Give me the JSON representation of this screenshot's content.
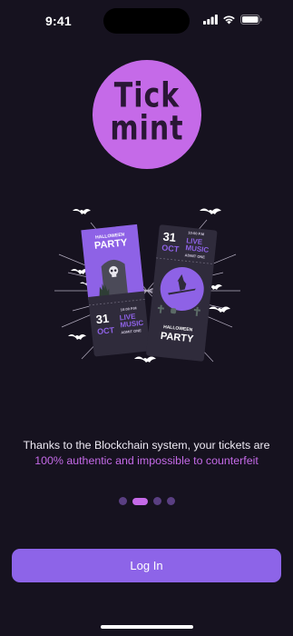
{
  "status_bar": {
    "time": "9:41"
  },
  "logo": {
    "line1": "Tick",
    "line2": "mint"
  },
  "hero": {
    "ticket_left": {
      "title_top": "HALLOWEEN",
      "title_main": "PARTY",
      "day": "31",
      "month": "OCT",
      "time": "10:00 P.M",
      "live": "LIVE",
      "music": "MUSIC",
      "admit": "ADMIT ONE"
    },
    "ticket_right": {
      "day": "31",
      "month": "OCT",
      "time": "10:00 P.M",
      "live": "LIVE",
      "music": "MUSIC",
      "admit": "ADMIT ONE",
      "title_top": "HALLOWEEN",
      "title_main": "PARTY"
    }
  },
  "onboarding": {
    "line1": "Thanks to the Blockchain system, your tickets are",
    "line2": "100% authentic and impossible to counterfeit",
    "page_count": 4,
    "active_page": 2
  },
  "actions": {
    "login_label": "Log In"
  },
  "colors": {
    "background": "#16121f",
    "accent_purple": "#c56ae8",
    "button": "#8d64e8",
    "dot_inactive": "#5a3f82"
  }
}
